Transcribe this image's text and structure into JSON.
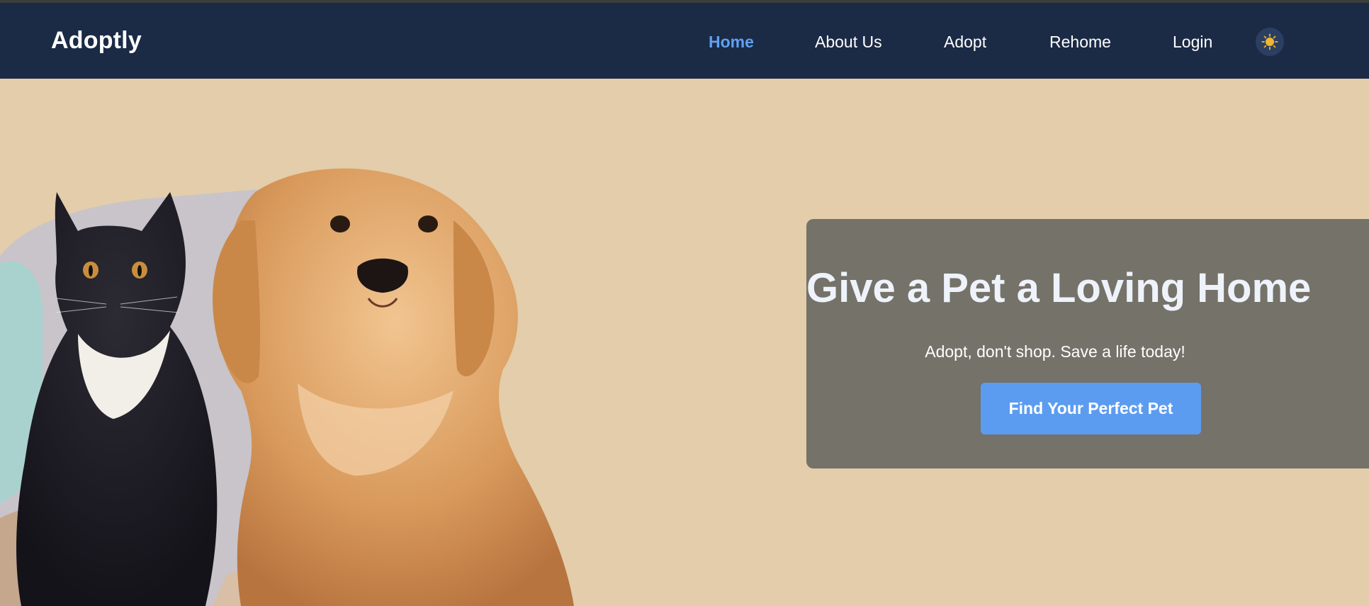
{
  "header": {
    "logo": "Adoptly",
    "nav": [
      {
        "label": "Home",
        "active": true
      },
      {
        "label": "About Us",
        "active": false
      },
      {
        "label": "Adopt",
        "active": false
      },
      {
        "label": "Rehome",
        "active": false
      },
      {
        "label": "Login",
        "active": false
      }
    ],
    "theme_toggle_icon": "sun-icon"
  },
  "hero": {
    "title": "Give a Pet a Loving Home",
    "subtitle": "Adopt, don't shop. Save a life today!",
    "cta_label": "Find Your Perfect Pet",
    "image_subject": "cat-and-dog-photo"
  },
  "colors": {
    "navbar_bg": "#1b2a45",
    "page_bg": "#e3cdab",
    "card_bg": "#757269",
    "accent": "#5c9cf0",
    "active_link": "#5fa0f2"
  }
}
